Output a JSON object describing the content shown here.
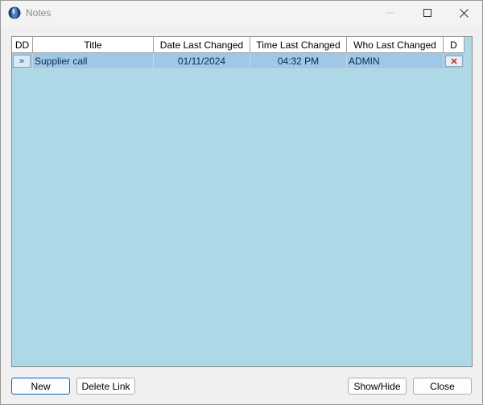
{
  "window": {
    "title": "Notes"
  },
  "grid": {
    "columns": [
      "DD",
      "Title",
      "Date Last Changed",
      "Time Last Changed",
      "Who Last Changed",
      "D"
    ],
    "rows": [
      {
        "dd": "»",
        "title": "Supplier call",
        "date": "01/11/2024",
        "time": "04:32 PM",
        "who": "ADMIN"
      }
    ]
  },
  "buttons": {
    "new": "New",
    "delete_link": "Delete Link",
    "show_hide": "Show/Hide",
    "close": "Close"
  },
  "colors": {
    "grid_background": "#add8e6",
    "selected_row": "#9ec8e8",
    "delete_icon": "#c0392b",
    "primary_border": "#0067c0"
  },
  "icons": {
    "app": "notes-app-icon",
    "minimize": "minimize-icon",
    "maximize": "maximize-icon",
    "close": "close-icon",
    "delete_row": "delete-x-icon"
  }
}
